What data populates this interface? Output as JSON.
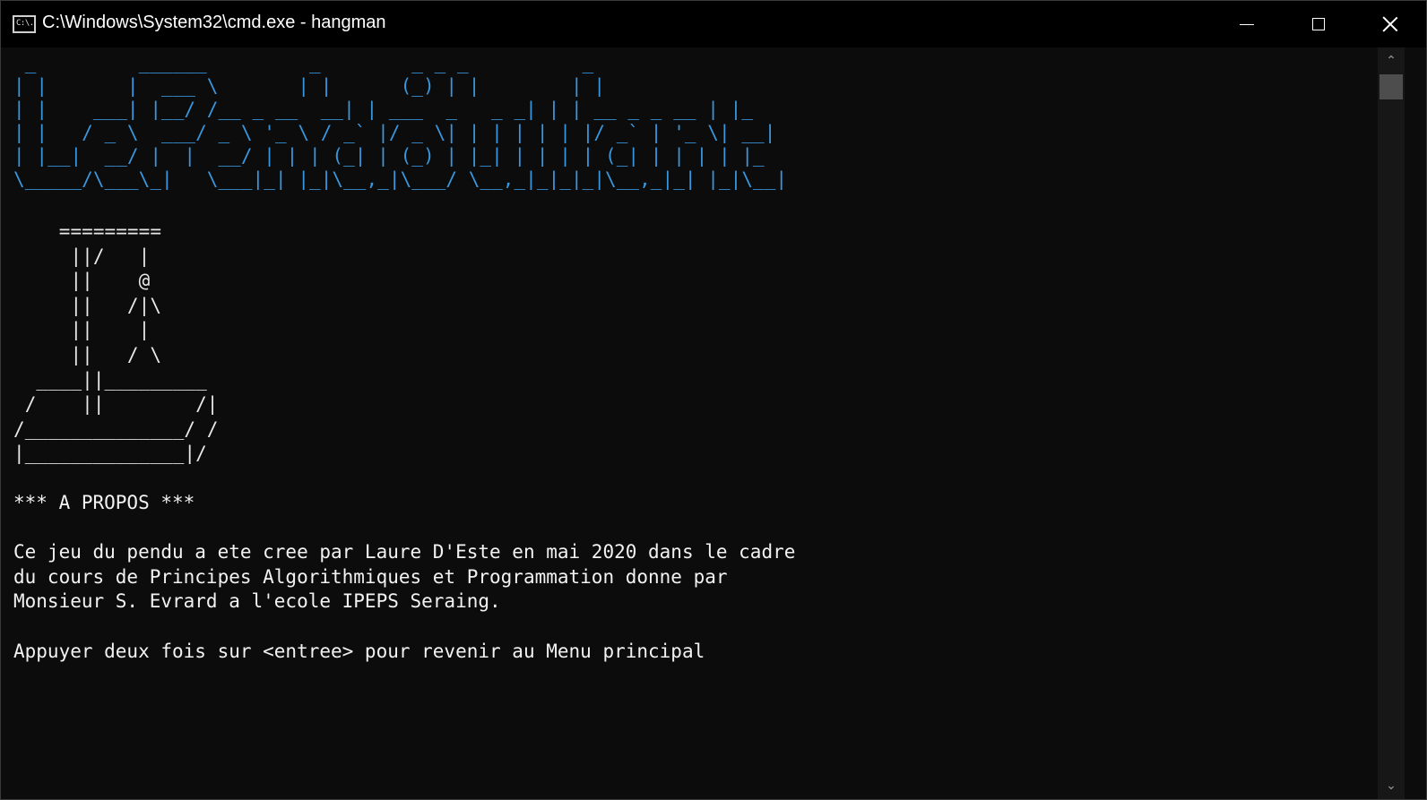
{
  "window": {
    "title": "C:\\Windows\\System32\\cmd.exe - hangman",
    "icon": "cmd-icon",
    "icon_text": "C:\\.",
    "controls": {
      "minimize": "minimize-icon",
      "maximize": "maximize-icon",
      "close": "close-icon"
    }
  },
  "banner": {
    "text": " _         ______         _        _ _ _          _\n| |       |  ___ \\       | |      (_) | |        | |\n| |    ___| |__/ /__ _ __  __| | ___  _   _ _| | | __ _ _ __ | |_\n| |   / _ \\  ___/ _ \\ '_ \\ / _` |/ _ \\| | | | | | |/ _` | '_ \\| __|\n| |__|  __/ |  |  __/ | | | (_| | (_) | |_| | | | | (_| | | | | |_\n\\_____/\\___\\_|   \\___|_| |_|\\__,_|\\___/ \\__,_|_|_|_|\\__,_|_| |_|\\__|",
    "color": "#3a96dd"
  },
  "gallows": {
    "text": "    =========\n     ||/   |\n     ||    @\n     ||   /|\\\n     ||    |\n     ||   / \\\n  ____||_________\n /    ||        /|\n/______________/ /\n|______________|/"
  },
  "content": {
    "about_title": "*** A PROPOS ***",
    "description_lines": [
      "Ce jeu du pendu a ete cree par Laure D'Este en mai 2020 dans le cadre",
      "du cours de Principes Algorithmiques et Programmation donne par",
      "Monsieur S. Evrard a l'ecole IPEPS Seraing."
    ],
    "prompt": "Appuyer deux fois sur <entree> pour revenir au Menu principal"
  },
  "scrollbar": {
    "up_arrow": "scroll-up-arrow-icon",
    "down_arrow": "scroll-down-arrow-icon",
    "up_glyph": "⌃",
    "down_glyph": "⌄"
  },
  "colors": {
    "background": "#0c0c0c",
    "titlebar": "#000000",
    "text": "#f2f2f2",
    "banner": "#3a96dd"
  }
}
